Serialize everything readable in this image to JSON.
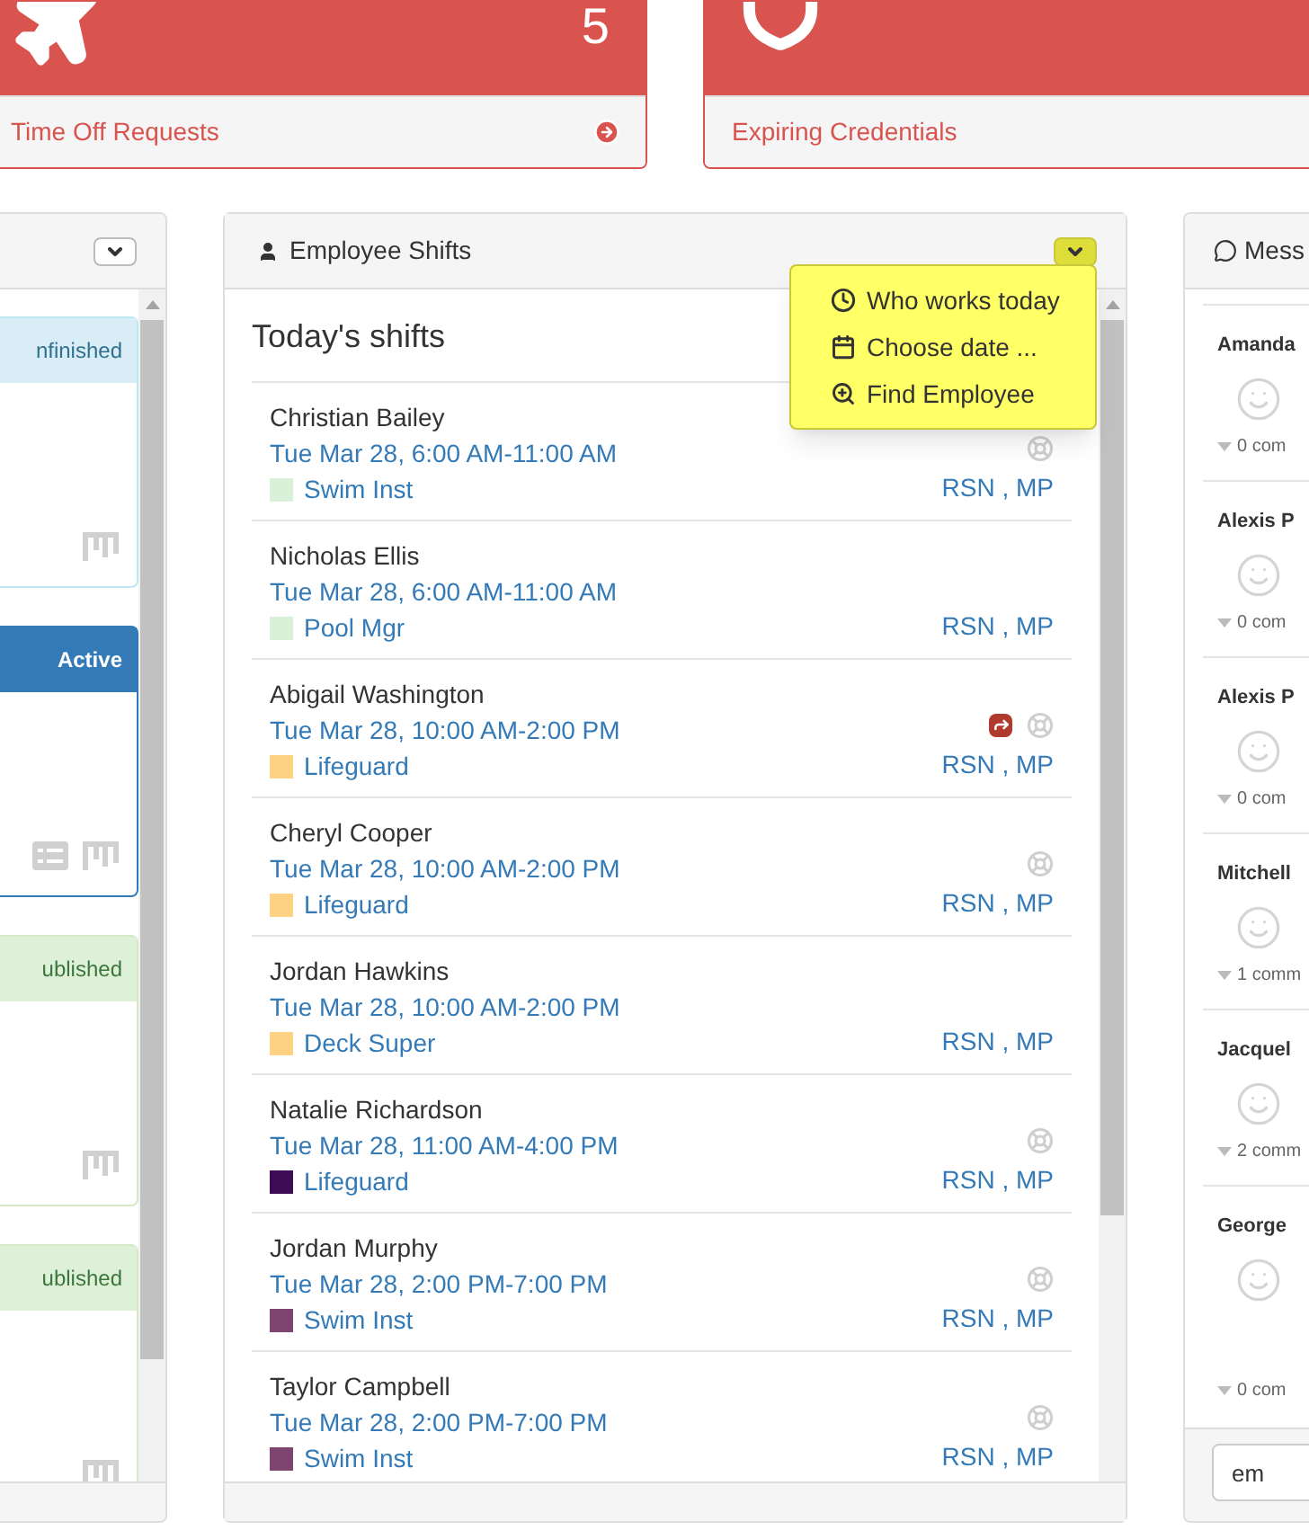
{
  "summary_cards": [
    {
      "kind": "plane",
      "count": "5",
      "label": "Time Off Requests",
      "link": true
    },
    {
      "kind": "shield",
      "label": "Expiring Credentials",
      "link": false
    }
  ],
  "left_panel": {
    "cards": [
      {
        "kind": "info",
        "status": "nfinished",
        "list_icon": false
      },
      {
        "kind": "primary",
        "status": "Active",
        "list_icon": true
      },
      {
        "kind": "success",
        "status": "ublished",
        "list_icon": false
      },
      {
        "kind": "success",
        "status": "ublished",
        "list_icon": false
      }
    ]
  },
  "shifts_panel": {
    "title": "Employee Shifts",
    "menu_open": true,
    "menu": [
      {
        "label": "Who works today"
      },
      {
        "label": "Choose date ..."
      },
      {
        "label": "Find Employee"
      }
    ],
    "heading": "Today's shifts",
    "shifts": [
      {
        "name": "Christian Bailey",
        "time": "Tue Mar 28, 6:00 AM-11:00 AM",
        "role": "Swim Inst",
        "color": "#d9f0d9",
        "swap": false,
        "lifebuoy": true,
        "staff": "RSN , MP"
      },
      {
        "name": "Nicholas Ellis",
        "time": "Tue Mar 28, 6:00 AM-11:00 AM",
        "role": "Pool Mgr",
        "color": "#d9f0d9",
        "swap": false,
        "lifebuoy": false,
        "staff": "RSN , MP"
      },
      {
        "name": "Abigail Washington",
        "time": "Tue Mar 28, 10:00 AM-2:00 PM",
        "role": "Lifeguard",
        "color": "#fdd283",
        "swap": true,
        "lifebuoy": true,
        "staff": "RSN , MP"
      },
      {
        "name": "Cheryl Cooper",
        "time": "Tue Mar 28, 10:00 AM-2:00 PM",
        "role": "Lifeguard",
        "color": "#fdd283",
        "swap": false,
        "lifebuoy": true,
        "staff": "RSN , MP"
      },
      {
        "name": "Jordan Hawkins",
        "time": "Tue Mar 28, 10:00 AM-2:00 PM",
        "role": "Deck Super",
        "color": "#fdd283",
        "swap": false,
        "lifebuoy": false,
        "staff": "RSN , MP"
      },
      {
        "name": "Natalie Richardson",
        "time": "Tue Mar 28, 11:00 AM-4:00 PM",
        "role": "Lifeguard",
        "color": "#3d0c55",
        "swap": false,
        "lifebuoy": true,
        "staff": "RSN , MP"
      },
      {
        "name": "Jordan Murphy",
        "time": "Tue Mar 28, 2:00 PM-7:00 PM",
        "role": "Swim Inst",
        "color": "#7d4570",
        "swap": false,
        "lifebuoy": true,
        "staff": "RSN , MP"
      },
      {
        "name": "Taylor Campbell",
        "time": "Tue Mar 28, 2:00 PM-7:00 PM",
        "role": "Swim Inst",
        "color": "#7d4570",
        "swap": false,
        "lifebuoy": true,
        "staff": "RSN , MP"
      }
    ]
  },
  "messages_panel": {
    "title": "Mess",
    "messages": [
      {
        "name": "Amanda",
        "comments": "0 com"
      },
      {
        "name": "Alexis P",
        "comments": "0 com"
      },
      {
        "name": "Alexis P",
        "comments": "0 com"
      },
      {
        "name": "Mitchell",
        "comments": "1 comm"
      },
      {
        "name": "Jacquel",
        "comments": "2 comm"
      },
      {
        "name": "George",
        "comments": "0 com"
      }
    ],
    "input": {
      "value": "em"
    }
  }
}
